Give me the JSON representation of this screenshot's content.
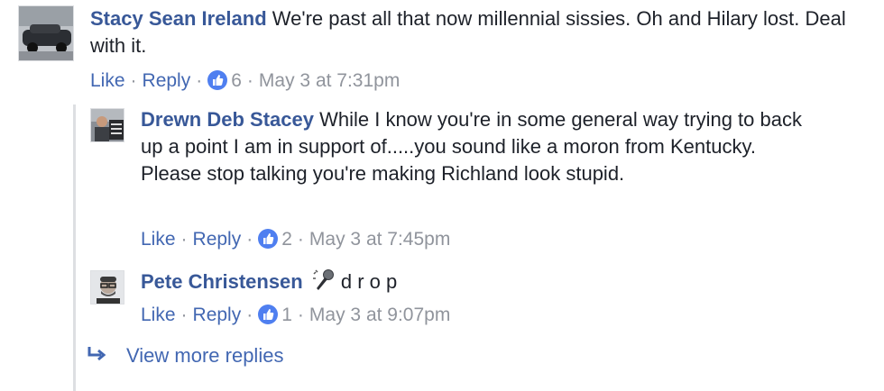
{
  "comments": [
    {
      "author": "Stacy Sean Ireland",
      "text": "We're past all that now millennial sissies. Oh and Hilary lost. Deal with it.",
      "like_label": "Like",
      "reply_label": "Reply",
      "reaction_count": "6",
      "timestamp": "May 3 at 7:31pm",
      "avatar_icon": "car-photo-avatar"
    }
  ],
  "replies": [
    {
      "author": "Drewn Deb Stacey",
      "text_line1": "While I know you're in some general way trying to back up a point I am in support of.....you sound like a moron from Kentucky.",
      "text_line2": "Please stop talking you're making Richland look stupid.",
      "like_label": "Like",
      "reply_label": "Reply",
      "reaction_count": "2",
      "timestamp": "May 3 at 7:45pm",
      "avatar_icon": "protest-sign-avatar"
    },
    {
      "author": "Pete Christensen",
      "emoji": "microphone-emoji",
      "text": "d r o p",
      "like_label": "Like",
      "reply_label": "Reply",
      "reaction_count": "1",
      "timestamp": "May 3 at 9:07pm",
      "avatar_icon": "man-glasses-avatar"
    }
  ],
  "view_more": {
    "label": "View more replies",
    "icon": "reply-arrow-icon"
  },
  "colors": {
    "link": "#385898",
    "action": "#4267b2",
    "meta": "#90949c",
    "like_badge": "#4f7ff0"
  }
}
